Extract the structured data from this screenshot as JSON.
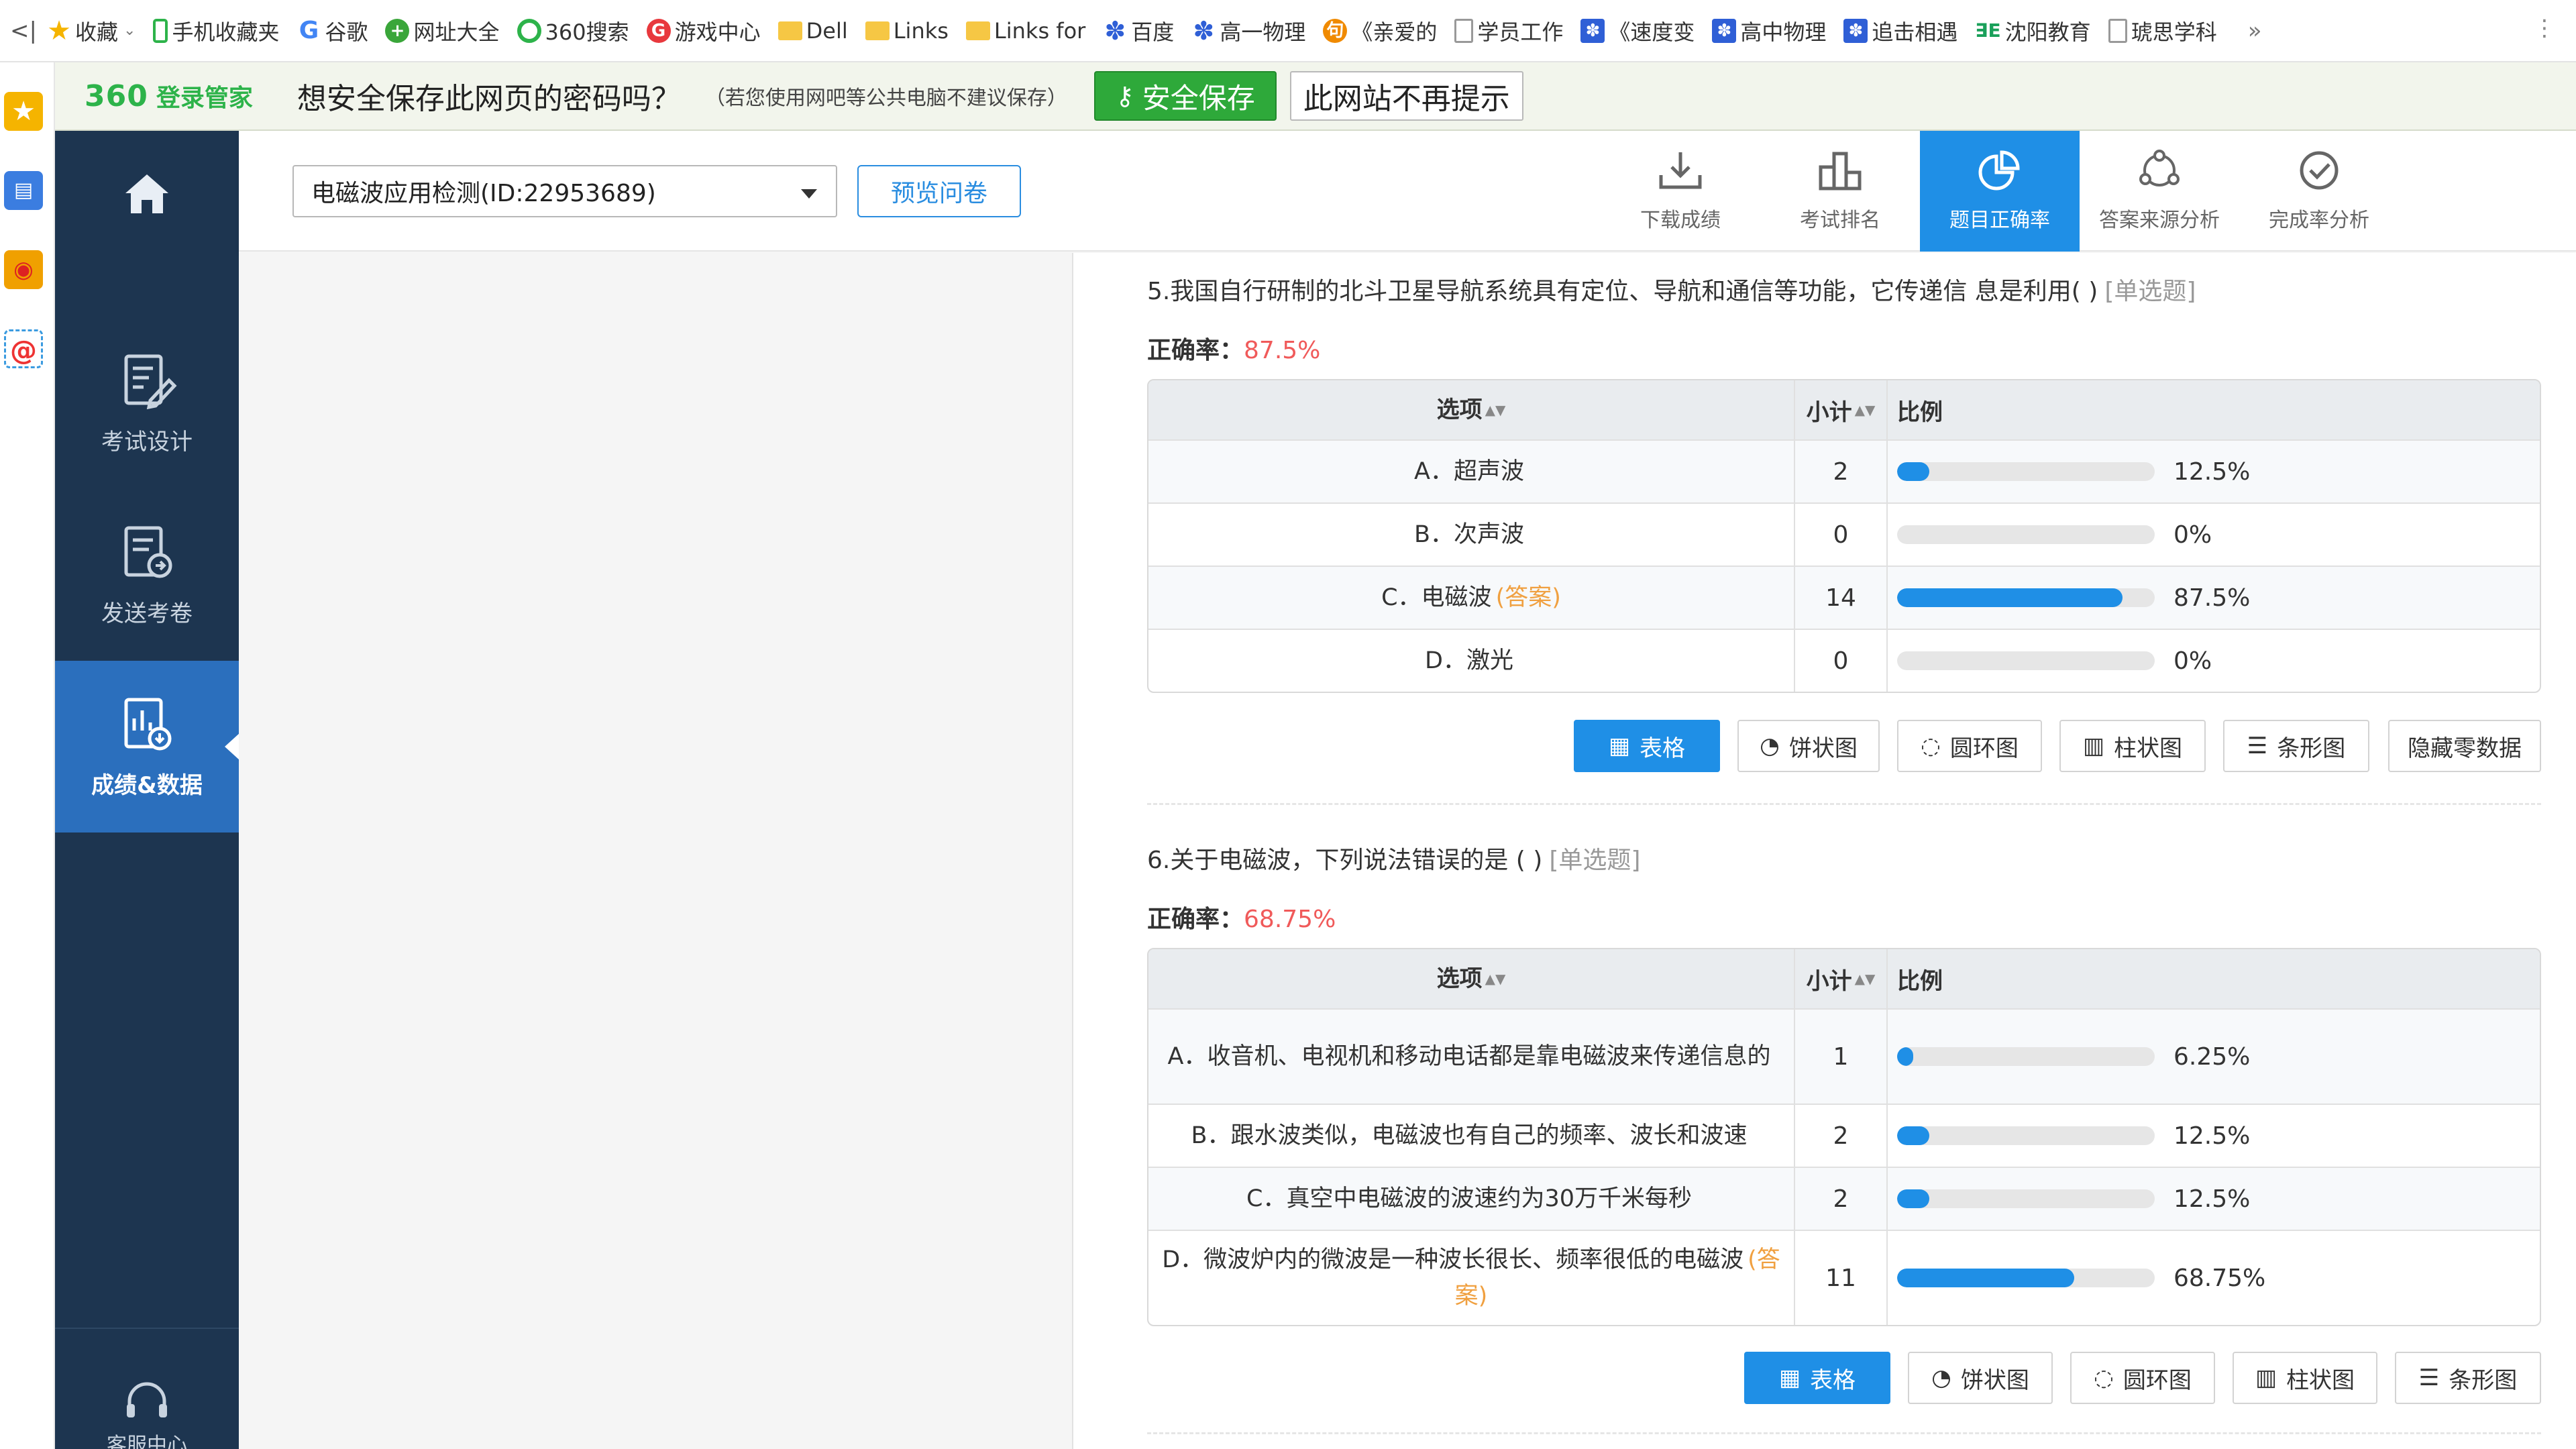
{
  "bookmarks": {
    "items": [
      {
        "label": "收藏",
        "icon": "star-icon"
      },
      {
        "label": "手机收藏夹",
        "icon": "phone-icon"
      },
      {
        "label": "谷歌",
        "icon": "google-icon"
      },
      {
        "label": "网址大全",
        "icon": "site-nav-icon"
      },
      {
        "label": "360搜索",
        "icon": "search-360-icon"
      },
      {
        "label": "游戏中心",
        "icon": "game-icon"
      },
      {
        "label": "Dell",
        "icon": "folder-icon"
      },
      {
        "label": "Links",
        "icon": "folder-icon"
      },
      {
        "label": "Links for",
        "icon": "folder-icon"
      },
      {
        "label": "百度",
        "icon": "baidu-icon"
      },
      {
        "label": "高一物理",
        "icon": "baidu-icon"
      },
      {
        "label": "《亲爱的",
        "icon": "video-icon"
      },
      {
        "label": "学员工作",
        "icon": "doc-icon"
      },
      {
        "label": "《速度变",
        "icon": "baidu-icon"
      },
      {
        "label": "高中物理",
        "icon": "baidu-icon"
      },
      {
        "label": "追击相遇",
        "icon": "baidu-icon"
      },
      {
        "label": "沈阳教育",
        "icon": "edu-icon"
      },
      {
        "label": "琥思学科",
        "icon": "doc-icon"
      }
    ],
    "more": "»"
  },
  "password_bar": {
    "logo": "360",
    "logo_sub": "登录管家",
    "question": "想安全保存此网页的密码吗？",
    "note": "（若您使用网吧等公共电脑不建议保存）",
    "save_label": "安全保存",
    "never_label": "此网站不再提示"
  },
  "sidebar": {
    "items": [
      {
        "label": "考试设计"
      },
      {
        "label": "发送考卷"
      },
      {
        "label": "成绩&数据"
      }
    ],
    "support_label": "客服中心"
  },
  "toolbar": {
    "survey_name": "电磁波应用检测(ID:22953689)",
    "preview_label": "预览问卷",
    "tools": [
      {
        "label": "下载成绩"
      },
      {
        "label": "考试排名"
      },
      {
        "label": "题目正确率"
      },
      {
        "label": "答案来源分析"
      },
      {
        "label": "完成率分析"
      }
    ]
  },
  "questions": [
    {
      "title": "5.我国自行研制的北斗卫星导航系统具有定位、导航和通信等功能，它传递信 息是利用( )",
      "type": "[单选题]",
      "rate_label": "正确率：",
      "rate": "87.5%",
      "headers": {
        "option": "选项",
        "count": "小计",
        "ratio": "比例"
      },
      "rows": [
        {
          "option": "A．超声波",
          "answer": "",
          "count": "2",
          "pct": "12.5%",
          "value": 0.125
        },
        {
          "option": "B．次声波",
          "answer": "",
          "count": "0",
          "pct": "0%",
          "value": 0
        },
        {
          "option": "C．电磁波",
          "answer": "(答案)",
          "count": "14",
          "pct": "87.5%",
          "value": 0.875
        },
        {
          "option": "D．激光",
          "answer": "",
          "count": "0",
          "pct": "0%",
          "value": 0
        }
      ],
      "buttons": [
        "表格",
        "饼状图",
        "圆环图",
        "柱状图",
        "条形图",
        "隐藏零数据"
      ]
    },
    {
      "title": "6.关于电磁波，下列说法错误的是 ( )",
      "type": "[单选题]",
      "rate_label": "正确率：",
      "rate": "68.75%",
      "headers": {
        "option": "选项",
        "count": "小计",
        "ratio": "比例"
      },
      "rows": [
        {
          "option": "A．收音机、电视机和移动电话都是靠电磁波来传递信息的",
          "answer": "",
          "count": "1",
          "pct": "6.25%",
          "value": 0.0625
        },
        {
          "option": "B．跟水波类似，电磁波也有自己的频率、波长和波速",
          "answer": "",
          "count": "2",
          "pct": "12.5%",
          "value": 0.125
        },
        {
          "option": "C．真空中电磁波的波速约为30万千米每秒",
          "answer": "",
          "count": "2",
          "pct": "12.5%",
          "value": 0.125
        },
        {
          "option": "D．微波炉内的微波是一种波长很长、频率很低的电磁波",
          "answer": "(答案)",
          "count": "11",
          "pct": "68.75%",
          "value": 0.6875
        }
      ],
      "buttons": [
        "表格",
        "饼状图",
        "圆环图",
        "柱状图",
        "条形图"
      ]
    }
  ],
  "colors": {
    "sidebar_bg": "#1d3550",
    "accent": "#1f8fe6",
    "rate": "#f05a5a",
    "answer": "#f0a040",
    "save_green": "#2ea93a"
  }
}
